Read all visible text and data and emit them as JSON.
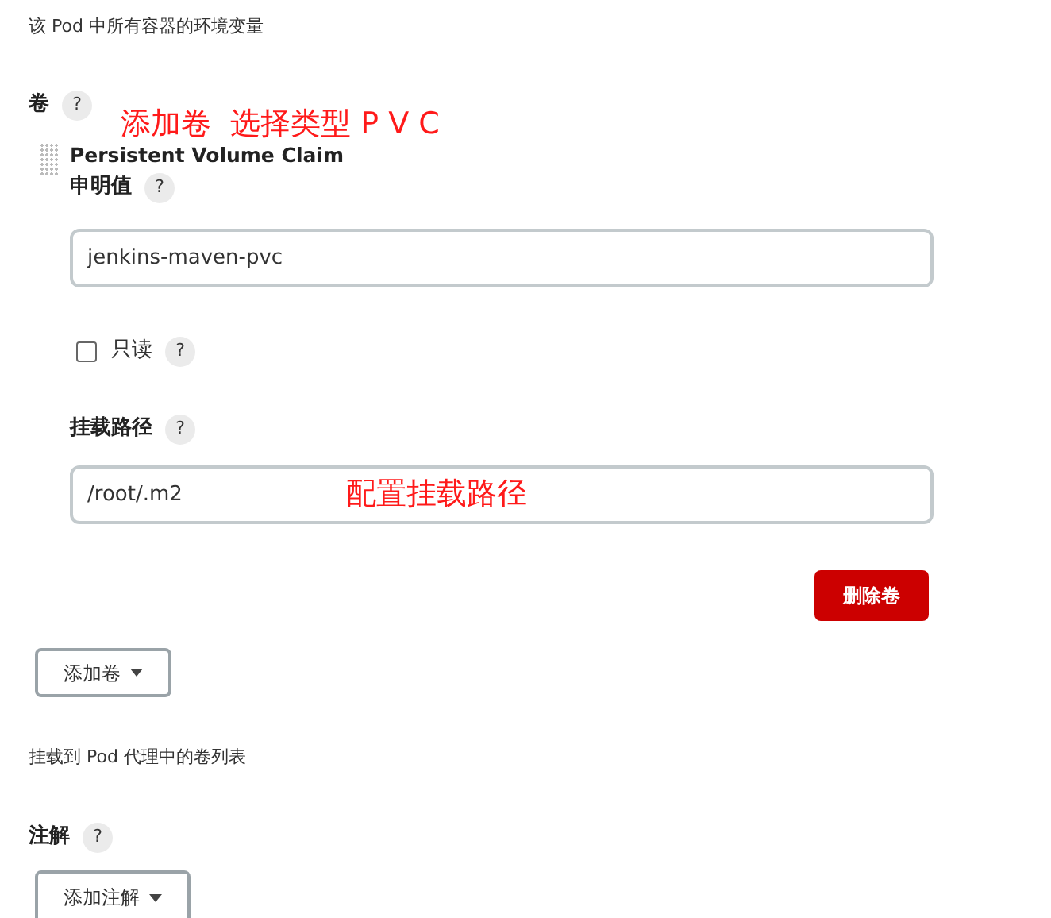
{
  "env_description": "该 Pod 中所有容器的环境变量",
  "volumes": {
    "label": "卷",
    "help": "?",
    "note": "添加卷  选择类型 P V C",
    "items": [
      {
        "type": "Persistent Volume Claim",
        "claim_label": "申明值",
        "claim_help": "?",
        "claim_value": "jenkins-maven-pvc",
        "readonly_label": "只读",
        "readonly_help": "?",
        "readonly": false,
        "mount_label": "挂载路径",
        "mount_help": "?",
        "mount_value": "/root/.m2",
        "mount_note": "配置挂载路径",
        "delete_button": "删除卷"
      }
    ],
    "add_button": "添加卷",
    "description": "挂载到 Pod 代理中的卷列表"
  },
  "annotations_section": {
    "label": "注解",
    "help": "?",
    "add_button": "添加注解"
  }
}
